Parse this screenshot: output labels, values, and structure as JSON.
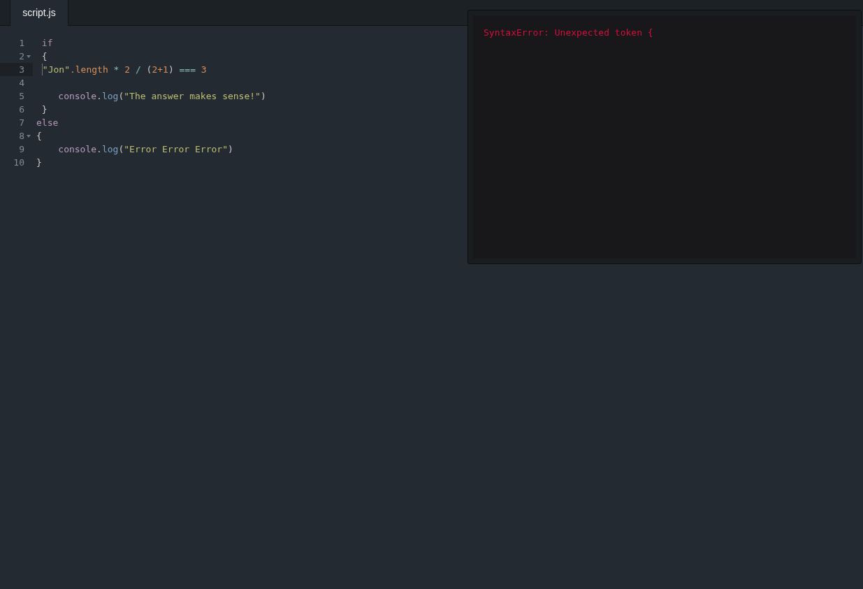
{
  "tabs": [
    {
      "label": "script.js",
      "selected": true
    }
  ],
  "editor": {
    "lines": [
      {
        "number": "1",
        "foldable": false,
        "active": false,
        "tokens": [
          {
            "kind": "keyword",
            "text": " if"
          }
        ]
      },
      {
        "number": "2",
        "foldable": true,
        "active": false,
        "tokens": [
          {
            "kind": "punctuation",
            "text": " {"
          }
        ]
      },
      {
        "number": "3",
        "foldable": false,
        "active": true,
        "tokens": [
          {
            "kind": "string",
            "text": " \"Jon\""
          },
          {
            "kind": "property",
            "text": ".length"
          },
          {
            "kind": "operator",
            "text": " * "
          },
          {
            "kind": "number",
            "text": "2"
          },
          {
            "kind": "operator",
            "text": " / "
          },
          {
            "kind": "punctuation",
            "text": "("
          },
          {
            "kind": "number",
            "text": "2+1"
          },
          {
            "kind": "punctuation",
            "text": ")"
          },
          {
            "kind": "operator",
            "text": " === "
          },
          {
            "kind": "number",
            "text": "3"
          }
        ]
      },
      {
        "number": "4",
        "foldable": false,
        "active": false
      },
      {
        "number": "5",
        "foldable": false,
        "active": false,
        "tokens": [
          {
            "kind": "variable",
            "text": "    console"
          },
          {
            "kind": "punctuation",
            "text": "."
          },
          {
            "kind": "function",
            "text": "log"
          },
          {
            "kind": "punctuation",
            "text": "("
          },
          {
            "kind": "string",
            "text": "\"The answer makes sense!\""
          },
          {
            "kind": "punctuation",
            "text": ")"
          }
        ]
      },
      {
        "number": "6",
        "foldable": false,
        "active": false,
        "tokens": [
          {
            "kind": "punctuation",
            "text": " }"
          }
        ]
      },
      {
        "number": "7",
        "foldable": false,
        "active": false,
        "tokens": [
          {
            "kind": "keyword",
            "text": "else"
          }
        ]
      },
      {
        "number": "8",
        "foldable": true,
        "active": false,
        "tokens": [
          {
            "kind": "punctuation",
            "text": "{"
          }
        ]
      },
      {
        "number": "9",
        "foldable": false,
        "active": false,
        "tokens": [
          {
            "kind": "variable",
            "text": "    console"
          },
          {
            "kind": "punctuation",
            "text": "."
          },
          {
            "kind": "function",
            "text": "log"
          },
          {
            "kind": "punctuation",
            "text": "("
          },
          {
            "kind": "string",
            "text": "\"Error Error Error\""
          },
          {
            "kind": "punctuation",
            "text": ")"
          }
        ]
      },
      {
        "number": "10",
        "foldable": false,
        "active": false,
        "tokens": [
          {
            "kind": "punctuation",
            "text": "}"
          }
        ]
      }
    ]
  },
  "console": {
    "error": "SyntaxError: Unexpected token {"
  }
}
